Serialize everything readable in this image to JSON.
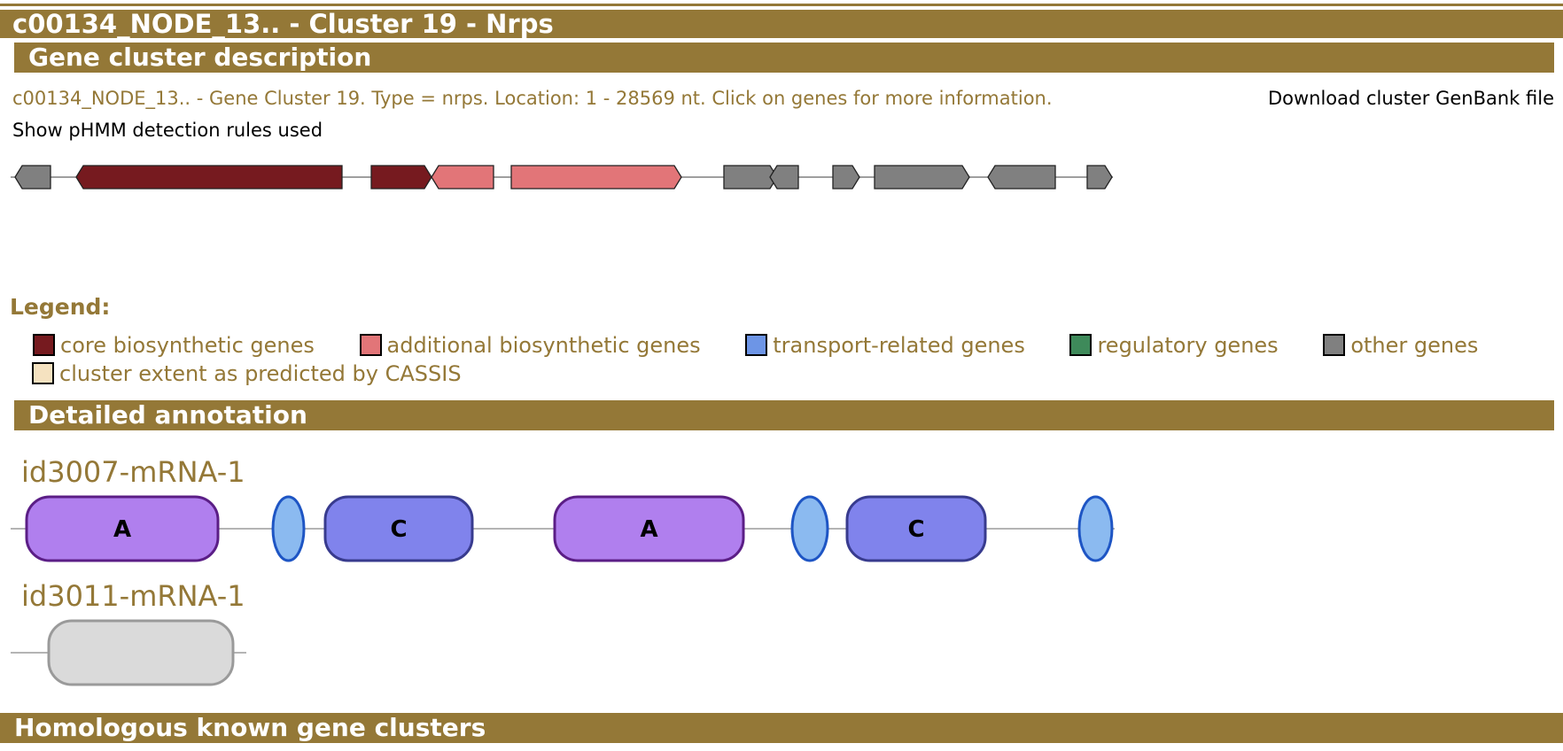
{
  "cluster_title": "c00134_NODE_13.. - Cluster 19 - Nrps",
  "sections": {
    "description": "Gene cluster description",
    "detailed": "Detailed annotation",
    "homologous": "Homologous known gene clusters"
  },
  "description_text": "c00134_NODE_13.. - Gene Cluster 19. Type = nrps. Location: 1 - 28569 nt. Click on genes for more information.",
  "download_label": "Download cluster GenBank file",
  "phmm_label": "Show pHMM detection rules used",
  "genes": [
    {
      "type": "other",
      "strand": "-"
    },
    {
      "type": "core",
      "strand": "-"
    },
    {
      "type": "core",
      "strand": "+"
    },
    {
      "type": "additional",
      "strand": "-"
    },
    {
      "type": "additional",
      "strand": "+"
    },
    {
      "type": "other",
      "strand": "+"
    },
    {
      "type": "other",
      "strand": "-"
    },
    {
      "type": "other",
      "strand": "+"
    },
    {
      "type": "other",
      "strand": "+"
    },
    {
      "type": "other",
      "strand": "-"
    },
    {
      "type": "other",
      "strand": "+"
    }
  ],
  "gene_colors": {
    "core": "#761A1F",
    "additional": "#E27578",
    "transport": "#6D95E6",
    "regulatory": "#3E8A5A",
    "other": "#808080",
    "cassis": "#F5E2C0"
  },
  "legend": {
    "title": "Legend:",
    "items": [
      {
        "label": "core biosynthetic genes",
        "color": "#761A1F"
      },
      {
        "label": "additional biosynthetic genes",
        "color": "#E27578"
      },
      {
        "label": "transport-related genes",
        "color": "#6D95E6"
      },
      {
        "label": "regulatory genes",
        "color": "#3E8A5A"
      },
      {
        "label": "other genes",
        "color": "#808080"
      },
      {
        "label": "cluster extent as predicted by CASSIS",
        "color": "#F5E2C0"
      }
    ]
  },
  "annotations": [
    {
      "name": "id3007-mRNA-1",
      "domains": [
        {
          "label": "A",
          "kind": "adenylation"
        },
        {
          "label": "",
          "kind": "pcp"
        },
        {
          "label": "C",
          "kind": "condensation"
        },
        {
          "label": "A",
          "kind": "adenylation"
        },
        {
          "label": "",
          "kind": "pcp"
        },
        {
          "label": "C",
          "kind": "condensation"
        },
        {
          "label": "",
          "kind": "pcp"
        }
      ]
    },
    {
      "name": "id3011-mRNA-1",
      "domains": [
        {
          "label": "",
          "kind": "other"
        }
      ]
    }
  ],
  "domain_colors": {
    "adenylation": {
      "fill": "#B07FEE",
      "stroke": "#5B1E86"
    },
    "condensation": {
      "fill": "#8083EC",
      "stroke": "#383B8E"
    },
    "pcp": {
      "fill": "#8BBAF0",
      "stroke": "#1E55C4"
    },
    "other": {
      "fill": "#DADADA",
      "stroke": "#9A9A9A"
    }
  }
}
